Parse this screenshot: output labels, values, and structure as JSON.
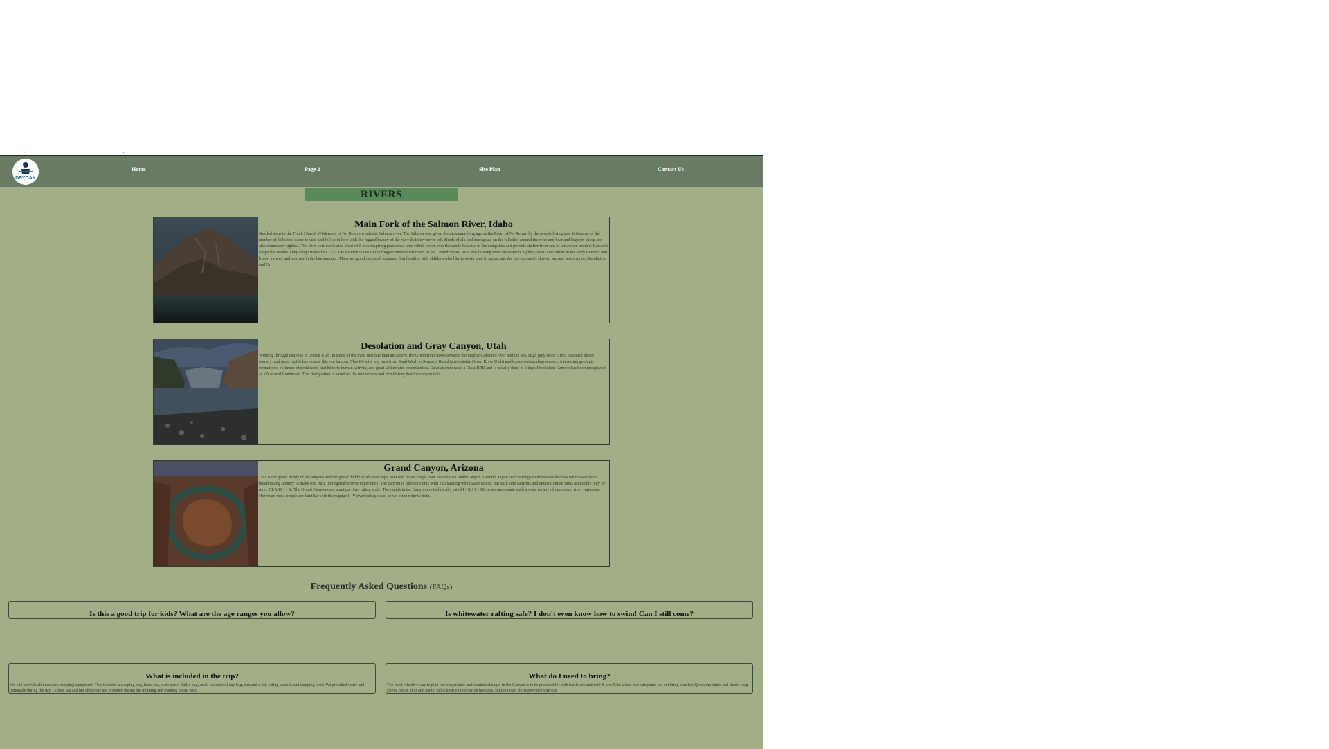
{
  "nav": {
    "logo_text": "DRYDAK",
    "links": [
      "Home",
      "Page 2",
      "Site Plan",
      "Contact Us"
    ]
  },
  "page_title": "RIVERS",
  "rivers": [
    {
      "title": "Main Fork of the Salmon River, Idaho",
      "text": "Nestled deep in the Frank Church Wilderness of No Return winds the Salmon river. The Salmon was given the nickname long ago as the River of No Return by the people living near it because of the number of folks that came to visit and fell so in love with the rugged beauty of the river that they never left. Herds of elk and deer graze on the hillsides around the river and bear and bighorn sheep are also commonly sighted. The river corridor is also lined with awe inspiring ponderosa pine which tower over the sandy beaches in the campsites and provide shelter from sun or rain when needed. Let's not forget the rapids! They range from class I-IV. The Salmon is one of the longest undammed rivers in the United States. As a free flowing river the water is higher, faster, and colder in the early summer and lower, slower, and warmer in the late summer. There are good rapids all summer...but families with children who like to swim tend to appreciate the late summer's slower, warmer water more. Desolation and Gr"
    },
    {
      "title": "Desolation and Gray Canyon, Utah",
      "text": "Winding through canyons in central Utah, in some of the most desolate land anywhere, the Green river flows towards the mighty Colorado river and the sea. High grey stone cliffs, beautiful desert scenery, and great rapids have made this run famous. This 84-mile trip runs from Sand Wash to Swaseys Rapid (just outside Green River Utah) and boasts outstanding scenery, interesting geologic formations, evidence of prehistoric and historic human activity, and great whitewater opportunities. Desolation is rated a Class II/III and is usually done in 6 days Desolation Canyon has been recognized as a National Landmark. This designation is based on the uniqueness and rich history that the canyon tells."
    },
    {
      "title": "Grand Canyon, Arizona",
      "text": "This is the grand daddy of all canyons and the grand daddy of all river trips. You will never forget your visit to the Grand Canyon. Grand Canyon river rafting combines world-class whitewater with breathtaking scenery to make one truly unforgettable river experience. The canyon is filled not only with exhilarating whitewater rapids, but with side canyons and ancient indian ruins accessible only by river. CLASS I - X: The Grand Canyon uses a unique river rating scale. The rapids in the Canyon are technically rated I - X ( 1 - 10) to accommodate such a wide variety of rapids and river variances. However, most people are familiar with the regular I - V river rating scale, so we often refer to both."
    }
  ],
  "faq": {
    "heading": "Frequently Asked Questions",
    "heading_sub": "(FAQs)",
    "items": [
      {
        "question": "Is this a good trip for kids? What are the age ranges you allow?",
        "answer": ""
      },
      {
        "question": "Is whitewater rafting safe? I don't even know how to swim! Can I still come?",
        "answer": ""
      },
      {
        "question": "What is included in the trip?",
        "answer": "We will provide all necessary camping equipment. This includes a sleeping bag, foam pad, waterproof duffle bag, small waterproof day bag, tent and a cot, eating utensils and camping chair. We provided water and lemonade during the day. Coffee, tea and hot chocolate are provided during the morning and evening hours. You"
      },
      {
        "question": "What do I need to bring?",
        "answer": "The most effective way to plan for temperature and weather changes in the Canyon is to be prepared for both hot & dry and cold & wet Rain jacket and rain pants- do not bring ponchos Quick dry shirts and shorts long sleeve cotton shirt and pants- helps keep you cooler on hot days. Button down shirts provide more sun"
      }
    ]
  },
  "colors": {
    "page_bg": "#a1ae88",
    "nav_bg": "#6a7b65",
    "title_bg": "#5a8a5c"
  }
}
